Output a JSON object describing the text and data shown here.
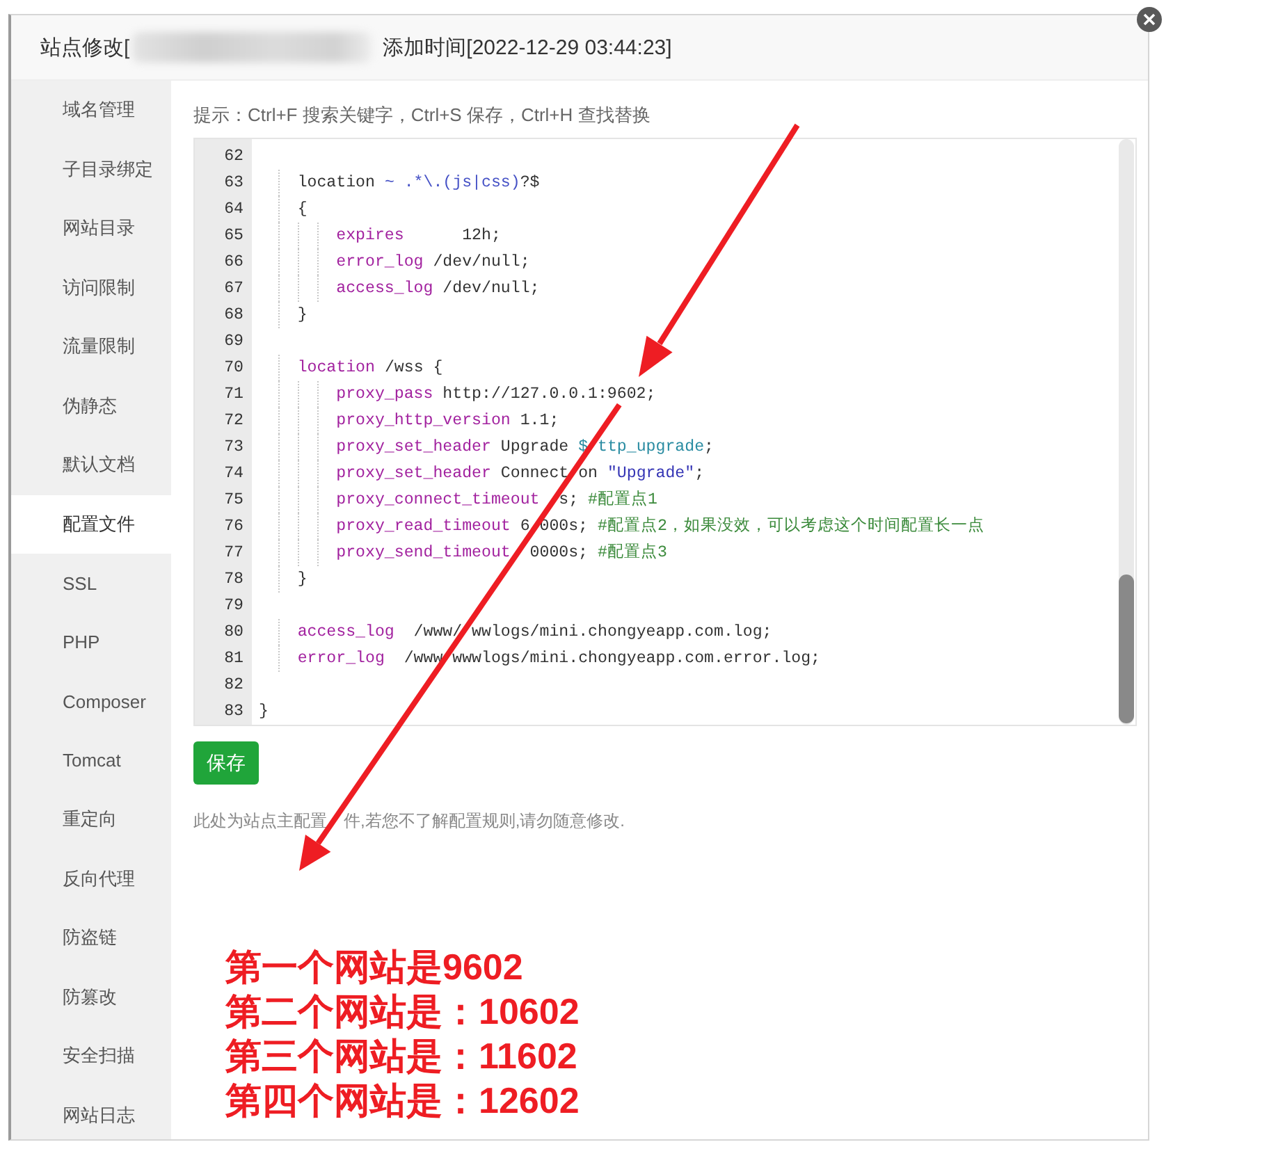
{
  "dialog": {
    "title": "站点修改[",
    "added_time": "添加时间[2022-12-29 03:44:23]"
  },
  "sidebar": {
    "items": [
      {
        "label": "域名管理",
        "selected": false
      },
      {
        "label": "子目录绑定",
        "selected": false
      },
      {
        "label": "网站目录",
        "selected": false
      },
      {
        "label": "访问限制",
        "selected": false
      },
      {
        "label": "流量限制",
        "selected": false
      },
      {
        "label": "伪静态",
        "selected": false
      },
      {
        "label": "默认文档",
        "selected": false
      },
      {
        "label": "配置文件",
        "selected": true
      },
      {
        "label": "SSL",
        "selected": false
      },
      {
        "label": "PHP",
        "selected": false
      },
      {
        "label": "Composer",
        "selected": false
      },
      {
        "label": "Tomcat",
        "selected": false
      },
      {
        "label": "重定向",
        "selected": false
      },
      {
        "label": "反向代理",
        "selected": false
      },
      {
        "label": "防盗链",
        "selected": false
      },
      {
        "label": "防篡改",
        "selected": false
      },
      {
        "label": "安全扫描",
        "selected": false
      },
      {
        "label": "网站日志",
        "selected": false
      }
    ]
  },
  "tip": "提示：Ctrl+F 搜索关键字，Ctrl+S 保存，Ctrl+H 查找替换",
  "editor": {
    "lines": [
      {
        "number": "62"
      },
      {
        "number": "63",
        "tokens": [
          {
            "kind": "plain",
            "text": "    location "
          },
          {
            "kind": "regex",
            "text": "~ .*\\.(js|css)"
          },
          {
            "kind": "plain",
            "text": "?$"
          }
        ]
      },
      {
        "number": "64",
        "tokens": [
          {
            "kind": "plain",
            "text": "    {"
          }
        ]
      },
      {
        "number": "65",
        "tokens": [
          {
            "kind": "keyword",
            "text": "        expires"
          },
          {
            "kind": "plain",
            "text": "      12h;"
          }
        ]
      },
      {
        "number": "66",
        "tokens": [
          {
            "kind": "keyword",
            "text": "        error_log"
          },
          {
            "kind": "plain",
            "text": " /dev/null;"
          }
        ]
      },
      {
        "number": "67",
        "tokens": [
          {
            "kind": "keyword",
            "text": "        access_log"
          },
          {
            "kind": "plain",
            "text": " /dev/null;"
          }
        ]
      },
      {
        "number": "68",
        "tokens": [
          {
            "kind": "plain",
            "text": "    }"
          }
        ]
      },
      {
        "number": "69"
      },
      {
        "number": "70",
        "tokens": [
          {
            "kind": "keyword",
            "text": "    location"
          },
          {
            "kind": "plain",
            "text": " /wss {"
          }
        ]
      },
      {
        "number": "71",
        "tokens": [
          {
            "kind": "keyword",
            "text": "        proxy_pass"
          },
          {
            "kind": "plain",
            "text": " http://127.0.0.1:9602;"
          }
        ]
      },
      {
        "number": "72",
        "tokens": [
          {
            "kind": "keyword",
            "text": "        proxy_http_version"
          },
          {
            "kind": "plain",
            "text": " 1.1;"
          }
        ]
      },
      {
        "number": "73",
        "tokens": [
          {
            "kind": "keyword",
            "text": "        proxy_set_header"
          },
          {
            "kind": "plain",
            "text": " Upgrade "
          },
          {
            "kind": "variable",
            "text": "$ ttp_upgrade"
          },
          {
            "kind": "plain",
            "text": ";"
          }
        ]
      },
      {
        "number": "74",
        "tokens": [
          {
            "kind": "keyword",
            "text": "        proxy_set_header"
          },
          {
            "kind": "plain",
            "text": " Connect on "
          },
          {
            "kind": "string",
            "text": "\"Upgrade\""
          },
          {
            "kind": "plain",
            "text": ";"
          }
        ]
      },
      {
        "number": "75",
        "tokens": [
          {
            "kind": "keyword",
            "text": "        proxy_connect_timeout"
          },
          {
            "kind": "plain",
            "text": "  s; "
          },
          {
            "kind": "comment",
            "text": "#配置点1"
          }
        ]
      },
      {
        "number": "76",
        "tokens": [
          {
            "kind": "keyword",
            "text": "        proxy_read_timeout"
          },
          {
            "kind": "plain",
            "text": " 6 000s; "
          },
          {
            "kind": "comment",
            "text": "#配置点2，如果没效，可以考虑这个时间配置长一点"
          }
        ]
      },
      {
        "number": "77",
        "tokens": [
          {
            "kind": "keyword",
            "text": "        proxy_send_timeout"
          },
          {
            "kind": "plain",
            "text": "  0000s; "
          },
          {
            "kind": "comment",
            "text": "#配置点3"
          }
        ]
      },
      {
        "number": "78",
        "tokens": [
          {
            "kind": "plain",
            "text": "    }"
          }
        ]
      },
      {
        "number": "79"
      },
      {
        "number": "80",
        "tokens": [
          {
            "kind": "keyword",
            "text": "    access_log"
          },
          {
            "kind": "plain",
            "text": "  /www/ wwlogs/mini.chongyeapp.com.log;"
          }
        ]
      },
      {
        "number": "81",
        "tokens": [
          {
            "kind": "keyword",
            "text": "    error_log"
          },
          {
            "kind": "plain",
            "text": "  /www wwwlogs/mini.chongyeapp.com.error.log;"
          }
        ]
      },
      {
        "number": "82"
      },
      {
        "number": "83",
        "tokens": [
          {
            "kind": "plain",
            "text": "}"
          }
        ]
      }
    ]
  },
  "save_button": "保存",
  "note": "此处为站点主配置　件,若您不了解配置规则,请勿随意修改.",
  "annotations": [
    "第一个网站是9602",
    "第二个网站是：10602",
    "第三个网站是：11602",
    "第四个网站是：12602"
  ]
}
